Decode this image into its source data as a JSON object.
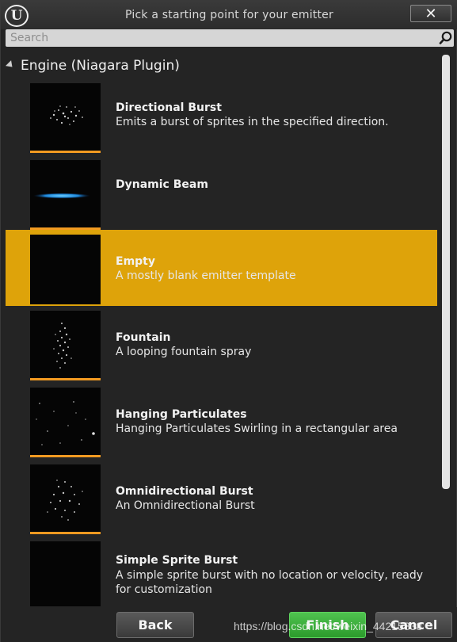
{
  "window": {
    "title": "Pick a starting point for your emitter",
    "logo_text": "U",
    "close_icon": "close-icon"
  },
  "search": {
    "placeholder": "Search",
    "value": ""
  },
  "category": {
    "label": "Engine (Niagara Plugin)",
    "expanded": true
  },
  "items": [
    {
      "name": "Directional Burst",
      "description": "Emits a burst of sprites in the specified direction."
    },
    {
      "name": "Dynamic Beam",
      "description": ""
    },
    {
      "name": "Empty",
      "description": "A mostly blank emitter template"
    },
    {
      "name": "Fountain",
      "description": "A looping fountain spray"
    },
    {
      "name": "Hanging Particulates",
      "description": "Hanging Particulates Swirling in a rectangular area"
    },
    {
      "name": "Omnidirectional Burst",
      "description": "An Omnidirectional Burst"
    },
    {
      "name": "Simple Sprite Burst",
      "description": "A simple sprite burst with no location or velocity, ready for customization"
    }
  ],
  "selected_index": 2,
  "footer": {
    "back_label": "Back",
    "finish_label": "Finish",
    "cancel_label": "Cancel"
  },
  "watermark": "https://blog.csdn.net/weixin_44215838",
  "colors": {
    "selection": "#dea30a",
    "thumb_bar": "#f29a21",
    "finish": "#3aaa3a"
  }
}
